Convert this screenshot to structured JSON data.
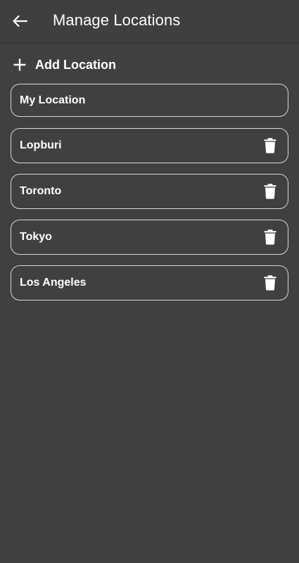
{
  "header": {
    "title": "Manage Locations",
    "back_icon": "arrow-left-icon"
  },
  "add_location": {
    "label": "Add Location",
    "icon": "plus-icon"
  },
  "locations": [
    {
      "name": "My Location",
      "deletable": false
    },
    {
      "name": "Lopburi",
      "deletable": true
    },
    {
      "name": "Toronto",
      "deletable": true
    },
    {
      "name": "Tokyo",
      "deletable": true
    },
    {
      "name": "Los Angeles",
      "deletable": true
    }
  ],
  "colors": {
    "background": "#404040",
    "text": "#ffffff",
    "card_border": "#d8d8d8"
  }
}
